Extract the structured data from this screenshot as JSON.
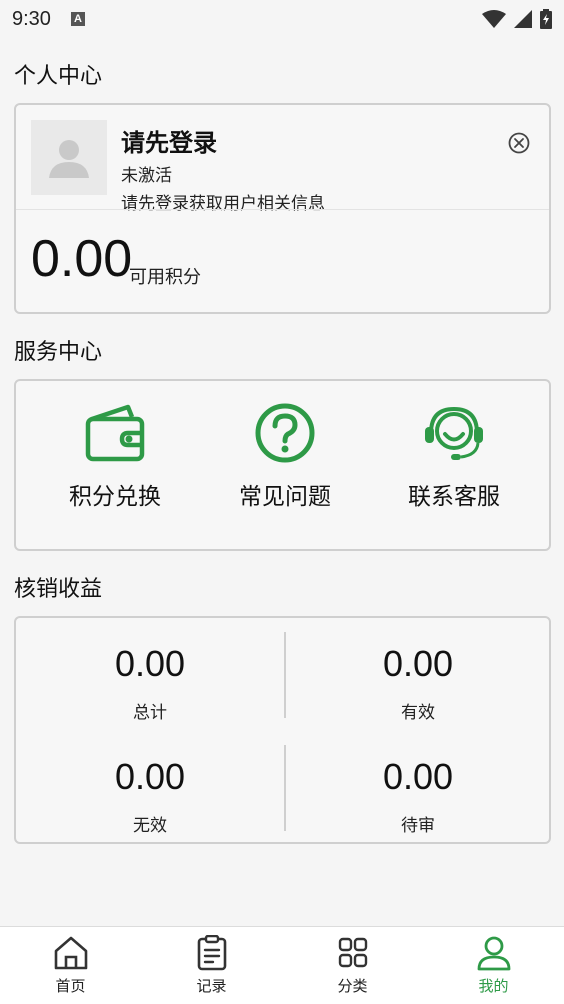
{
  "status_bar": {
    "time": "9:30",
    "notification_icon": "A"
  },
  "profile": {
    "section_title": "个人中心",
    "login_title": "请先登录",
    "status": "未激活",
    "info": "请先登录获取用户相关信息",
    "points_value": "0.00",
    "points_label": "可用积分"
  },
  "services": {
    "section_title": "服务中心",
    "items": [
      {
        "label": "积分兑换",
        "icon": "wallet-icon"
      },
      {
        "label": "常见问题",
        "icon": "question-icon"
      },
      {
        "label": "联系客服",
        "icon": "customer-service-icon"
      }
    ]
  },
  "earnings": {
    "section_title": "核销收益",
    "stats": [
      {
        "value": "0.00",
        "label": "总计"
      },
      {
        "value": "0.00",
        "label": "有效"
      },
      {
        "value": "0.00",
        "label": "无效"
      },
      {
        "value": "0.00",
        "label": "待审"
      }
    ]
  },
  "nav": {
    "items": [
      {
        "label": "首页",
        "icon": "home-icon"
      },
      {
        "label": "记录",
        "icon": "clipboard-icon"
      },
      {
        "label": "分类",
        "icon": "category-icon"
      },
      {
        "label": "我的",
        "icon": "user-icon",
        "active": true
      }
    ]
  },
  "colors": {
    "accent": "#2e9a47",
    "border": "#cfcfcf"
  }
}
